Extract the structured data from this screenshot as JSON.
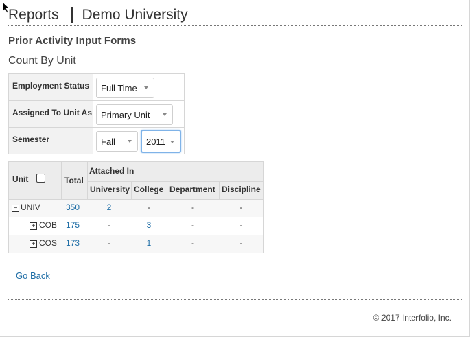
{
  "header": {
    "reports": "Reports",
    "institution": "Demo University"
  },
  "subtitle": "Prior Activity Input Forms",
  "section_title": "Count By Unit",
  "filters": {
    "employment_status": {
      "label": "Employment Status",
      "value": "Full Time"
    },
    "assigned_to_unit": {
      "label": "Assigned To Unit As",
      "value": "Primary Unit"
    },
    "semester": {
      "label": "Semester",
      "term": "Fall",
      "year": "2011"
    }
  },
  "grid": {
    "headers": {
      "unit": "Unit",
      "total": "Total",
      "attached_in": "Attached In",
      "university": "University",
      "college": "College",
      "department": "Department",
      "discipline": "Discipline"
    },
    "rows": [
      {
        "expander": "−",
        "unit": "UNIV",
        "total": "350",
        "university": "2",
        "college": "-",
        "department": "-",
        "discipline": "-"
      },
      {
        "expander": "+",
        "unit": "COB",
        "total": "175",
        "university": "-",
        "college": "3",
        "department": "-",
        "discipline": "-"
      },
      {
        "expander": "+",
        "unit": "COS",
        "total": "173",
        "university": "-",
        "college": "1",
        "department": "-",
        "discipline": "-"
      }
    ]
  },
  "go_back": "Go Back",
  "footer": "© 2017 Interfolio, Inc."
}
